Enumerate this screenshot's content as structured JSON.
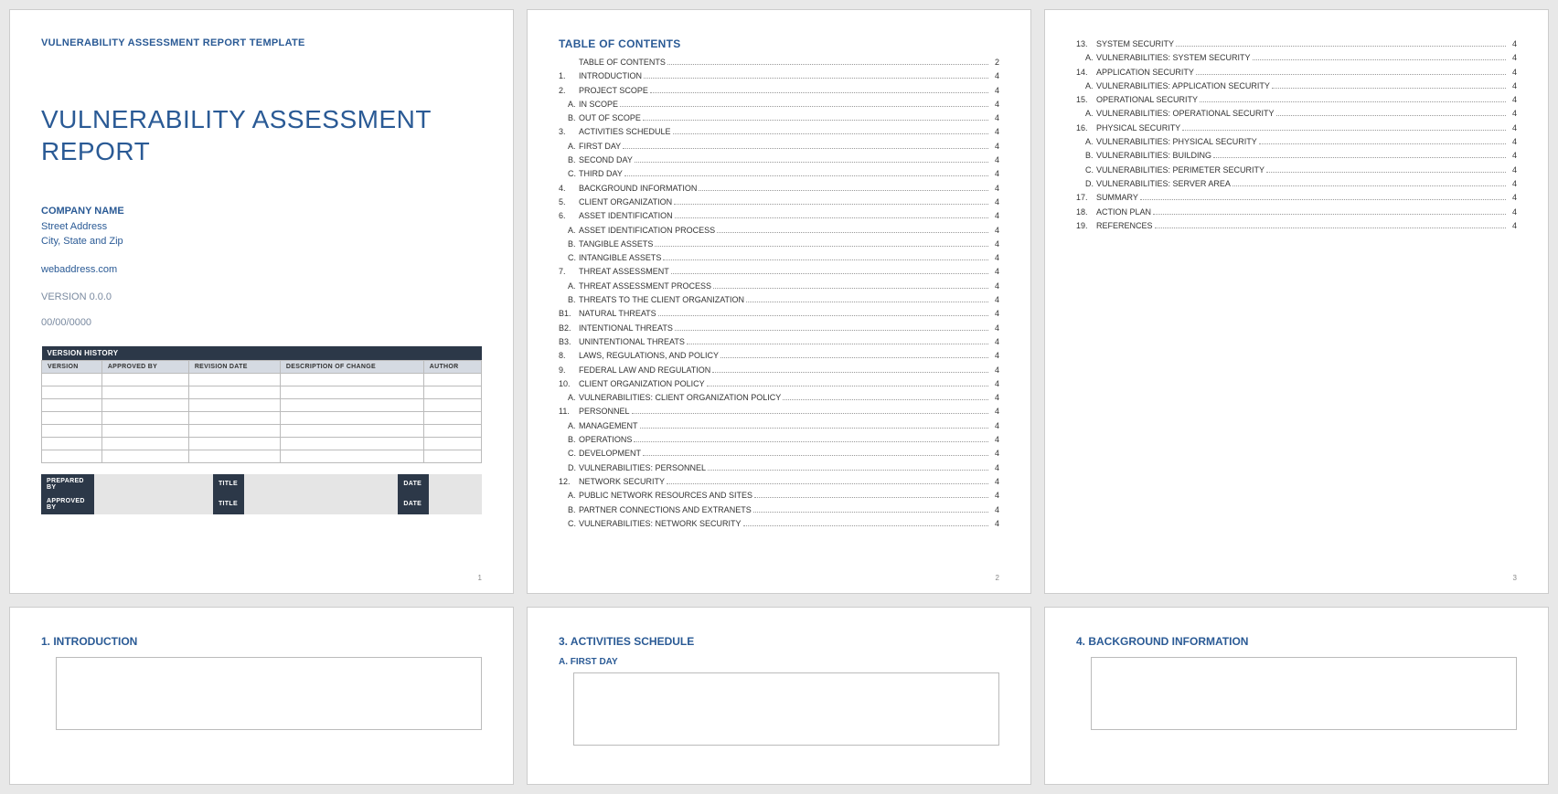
{
  "header": {
    "template_label": "VULNERABILITY ASSESSMENT REPORT TEMPLATE"
  },
  "title": "VULNERABILITY ASSESSMENT REPORT",
  "company": {
    "name": "COMPANY NAME",
    "street": "Street Address",
    "city": "City, State and Zip",
    "web": "webaddress.com"
  },
  "version": "VERSION 0.0.0",
  "date": "00/00/0000",
  "version_history": {
    "header": "VERSION HISTORY",
    "cols": [
      "VERSION",
      "APPROVED BY",
      "REVISION DATE",
      "DESCRIPTION OF CHANGE",
      "AUTHOR"
    ]
  },
  "sign": {
    "prepared": "PREPARED BY",
    "approved": "APPROVED BY",
    "title": "TITLE",
    "date": "DATE"
  },
  "toc_header": "TABLE OF CONTENTS",
  "toc2": [
    {
      "n": "",
      "t": "TABLE OF CONTENTS",
      "p": "2"
    },
    {
      "n": "1.",
      "t": "INTRODUCTION",
      "p": "4"
    },
    {
      "n": "2.",
      "t": "PROJECT SCOPE",
      "p": "4"
    },
    {
      "n": "A.",
      "t": "IN SCOPE",
      "p": "4",
      "s": 1
    },
    {
      "n": "B.",
      "t": "OUT OF SCOPE",
      "p": "4",
      "s": 1
    },
    {
      "n": "3.",
      "t": "ACTIVITIES SCHEDULE",
      "p": "4"
    },
    {
      "n": "A.",
      "t": "FIRST DAY",
      "p": "4",
      "s": 1
    },
    {
      "n": "B.",
      "t": "SECOND DAY",
      "p": "4",
      "s": 1
    },
    {
      "n": "C.",
      "t": "THIRD DAY",
      "p": "4",
      "s": 1
    },
    {
      "n": "4.",
      "t": "BACKGROUND INFORMATION",
      "p": "4"
    },
    {
      "n": "5.",
      "t": "CLIENT ORGANIZATION",
      "p": "4"
    },
    {
      "n": "6.",
      "t": "ASSET IDENTIFICATION",
      "p": "4"
    },
    {
      "n": "A.",
      "t": "ASSET IDENTIFICATION PROCESS",
      "p": "4",
      "s": 1
    },
    {
      "n": "B.",
      "t": "TANGIBLE ASSETS",
      "p": "4",
      "s": 1
    },
    {
      "n": "C.",
      "t": "INTANGIBLE ASSETS",
      "p": "4",
      "s": 1
    },
    {
      "n": "7.",
      "t": "THREAT ASSESSMENT",
      "p": "4"
    },
    {
      "n": "A.",
      "t": "THREAT ASSESSMENT PROCESS",
      "p": "4",
      "s": 1
    },
    {
      "n": "B.",
      "t": "THREATS TO THE CLIENT ORGANIZATION",
      "p": "4",
      "s": 1
    },
    {
      "n": "B1.",
      "t": "NATURAL THREATS",
      "p": "4"
    },
    {
      "n": "B2.",
      "t": "INTENTIONAL THREATS",
      "p": "4"
    },
    {
      "n": "B3.",
      "t": "UNINTENTIONAL THREATS",
      "p": "4"
    },
    {
      "n": "8.",
      "t": "LAWS, REGULATIONS, AND POLICY",
      "p": "4"
    },
    {
      "n": "9.",
      "t": "FEDERAL LAW AND REGULATION",
      "p": "4"
    },
    {
      "n": "10.",
      "t": "CLIENT ORGANIZATION POLICY",
      "p": "4"
    },
    {
      "n": "A.",
      "t": "VULNERABILITIES: CLIENT ORGANIZATION POLICY",
      "p": "4",
      "s": 1
    },
    {
      "n": "11.",
      "t": "PERSONNEL",
      "p": "4"
    },
    {
      "n": "A.",
      "t": "MANAGEMENT",
      "p": "4",
      "s": 1
    },
    {
      "n": "B.",
      "t": "OPERATIONS",
      "p": "4",
      "s": 1
    },
    {
      "n": "C.",
      "t": "DEVELOPMENT",
      "p": "4",
      "s": 1
    },
    {
      "n": "D.",
      "t": "VULNERABILITIES: PERSONNEL",
      "p": "4",
      "s": 1
    },
    {
      "n": "12.",
      "t": "NETWORK SECURITY",
      "p": "4"
    },
    {
      "n": "A.",
      "t": "PUBLIC NETWORK RESOURCES AND SITES",
      "p": "4",
      "s": 1
    },
    {
      "n": "B.",
      "t": "PARTNER CONNECTIONS AND EXTRANETS",
      "p": "4",
      "s": 1
    },
    {
      "n": "C.",
      "t": "VULNERABILITIES: NETWORK SECURITY",
      "p": "4",
      "s": 1
    }
  ],
  "toc3": [
    {
      "n": "13.",
      "t": "SYSTEM SECURITY",
      "p": "4"
    },
    {
      "n": "A.",
      "t": "VULNERABILITIES: SYSTEM SECURITY",
      "p": "4",
      "s": 1
    },
    {
      "n": "14.",
      "t": "APPLICATION SECURITY",
      "p": "4"
    },
    {
      "n": "A.",
      "t": "VULNERABILITIES: APPLICATION SECURITY",
      "p": "4",
      "s": 1
    },
    {
      "n": "15.",
      "t": "OPERATIONAL SECURITY",
      "p": "4"
    },
    {
      "n": "A.",
      "t": "VULNERABILITIES: OPERATIONAL SECURITY",
      "p": "4",
      "s": 1
    },
    {
      "n": "16.",
      "t": "PHYSICAL SECURITY",
      "p": "4"
    },
    {
      "n": "A.",
      "t": "VULNERABILITIES: PHYSICAL SECURITY",
      "p": "4",
      "s": 1
    },
    {
      "n": "B.",
      "t": "VULNERABILITIES: BUILDING",
      "p": "4",
      "s": 1
    },
    {
      "n": "C.",
      "t": "VULNERABILITIES: PERIMETER SECURITY",
      "p": "4",
      "s": 1
    },
    {
      "n": "D.",
      "t": "VULNERABILITIES: SERVER AREA",
      "p": "4",
      "s": 1
    },
    {
      "n": "17.",
      "t": "SUMMARY",
      "p": "4"
    },
    {
      "n": "18.",
      "t": "ACTION PLAN",
      "p": "4"
    },
    {
      "n": "19.",
      "t": "REFERENCES",
      "p": "4"
    }
  ],
  "sections": {
    "s1": "1. INTRODUCTION",
    "s3": "3. ACTIVITIES SCHEDULE",
    "s3a": "A. FIRST DAY",
    "s4": "4. BACKGROUND INFORMATION"
  },
  "pagenum": {
    "p1": "1",
    "p2": "2",
    "p3": "3"
  }
}
